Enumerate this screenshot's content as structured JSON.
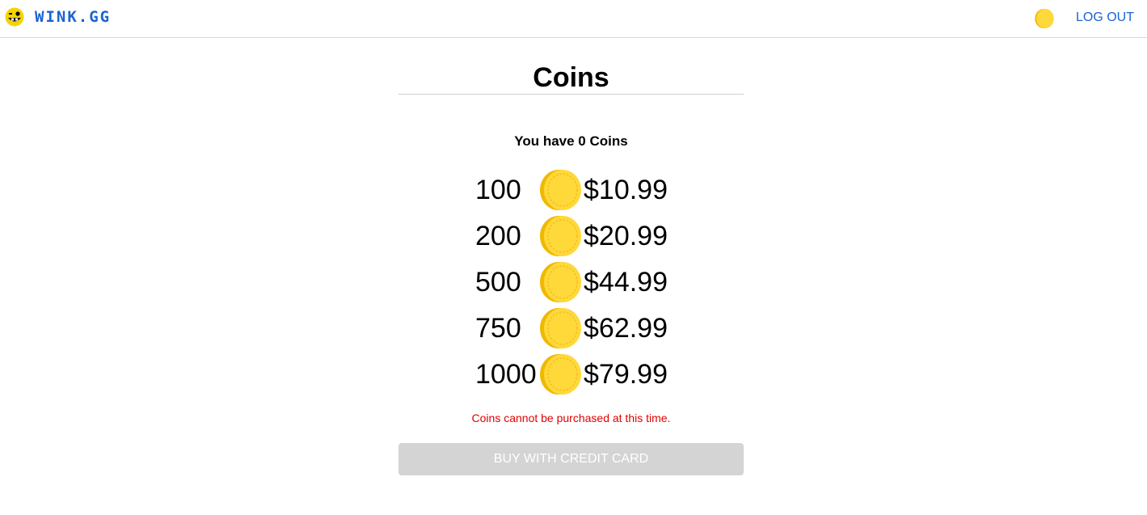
{
  "header": {
    "brand": "WINK.GG",
    "logout_label": "LOG OUT"
  },
  "page": {
    "title": "Coins",
    "balance_text": "You have 0 Coins"
  },
  "packages": [
    {
      "amount": "100",
      "price": "$10.99"
    },
    {
      "amount": "200",
      "price": "$20.99"
    },
    {
      "amount": "500",
      "price": "$44.99"
    },
    {
      "amount": "750",
      "price": "$62.99"
    },
    {
      "amount": "1000",
      "price": "$79.99"
    }
  ],
  "error_message": "Coins cannot be purchased at this time.",
  "buy_button": {
    "label": "BUY WITH CREDIT CARD",
    "disabled": true
  },
  "icons": {
    "logo": "winking-face-icon",
    "coin": "coin-icon"
  },
  "colors": {
    "link": "#1a63d4",
    "coin": "#ffd83a",
    "error": "#e20000",
    "disabled_button": "#d4d4d4"
  }
}
